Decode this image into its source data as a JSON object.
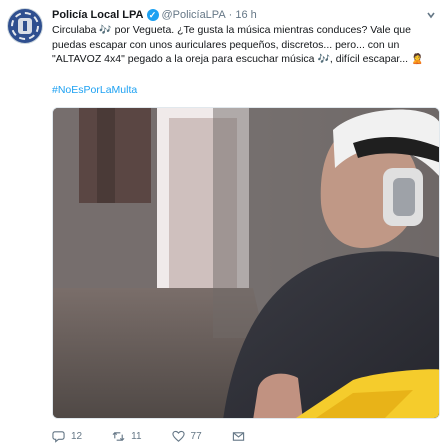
{
  "tweet": {
    "display_name": "Policía Local LPA",
    "verified_glyph": "✓",
    "handle": "@PolicíaLPA",
    "separator": "·",
    "time": "16 h",
    "text_lines": [
      [
        "Circulaba ",
        "🎶",
        " por Vegueta. ¿Te gusta la música mientras conduces? Vale que"
      ],
      [
        "puedas escapar con unos auriculares pequeños, discretos... pero... con un"
      ],
      [
        "\"ALTAVOZ 4x4\" pegado a la oreja para escuchar música ",
        "🎶",
        ", difícil escapar... ",
        "🙎"
      ]
    ],
    "hashtag": "#NoEsPorLaMulta",
    "stats": {
      "replies": "12",
      "retweets": "11",
      "likes": "77"
    }
  },
  "icons": {
    "avatar": "police-badge-avatar",
    "verified": "verified-badge-icon",
    "caret": "chevron-down-icon",
    "reply": "reply-icon",
    "retweet": "retweet-icon",
    "like": "heart-icon",
    "message": "message-icon"
  },
  "colors": {
    "accent": "#1da1f2",
    "text": "#14171a",
    "muted": "#657786"
  }
}
